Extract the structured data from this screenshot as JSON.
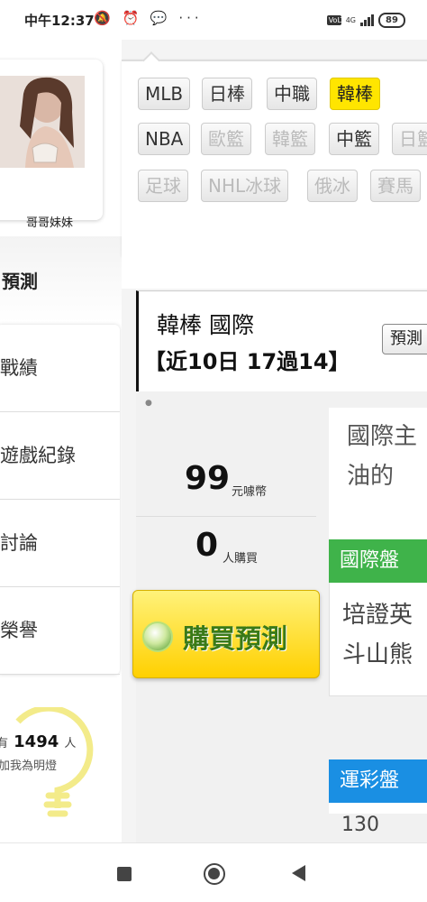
{
  "status_bar": {
    "time": "中午12:37",
    "icons_left": "🔕 ⏰ 💬 ···",
    "volte": "VoLTE",
    "network": "4G",
    "battery": "89"
  },
  "profile": {
    "name": "哥哥妹妹"
  },
  "sidebar": {
    "heading": "預測",
    "items": [
      {
        "label": "戰績"
      },
      {
        "label": "遊戲紀錄"
      },
      {
        "label": "討論"
      },
      {
        "label": "榮譽"
      }
    ],
    "fans": {
      "prefix": "有",
      "count": "1494",
      "suffix": "人",
      "subtitle": "加我為明燈"
    }
  },
  "sport_tabs": {
    "row1": [
      {
        "label": "MLB"
      },
      {
        "label": "日棒"
      },
      {
        "label": "中職"
      },
      {
        "label": "韓棒",
        "active": true
      }
    ],
    "row2": [
      {
        "label": "NBA"
      },
      {
        "label": "歐籃"
      },
      {
        "label": "韓籃"
      },
      {
        "label": "中籃"
      },
      {
        "label": "日籃"
      }
    ],
    "row3": [
      {
        "label": "足球"
      },
      {
        "label": "NHL冰球"
      },
      {
        "label": "俄冰"
      },
      {
        "label": "賽馬"
      }
    ]
  },
  "detail": {
    "title": "韓棒 國際",
    "record": "【近10日 17過14】",
    "predict_button": "預測",
    "price": "99",
    "price_unit": "元噱幣",
    "buyers": "0",
    "buyers_unit": "人購買",
    "buy_button": "購買預測",
    "info_title": "國際主\n油的",
    "board_intl": "國際盤",
    "board_intl_text": "培證英\n斗山熊",
    "board_sports": "運彩盤",
    "board_sports_value": "130"
  },
  "colors": {
    "active_tab": "#ffe500",
    "intl_board": "#3fb34a",
    "sports_board": "#1a8fe3",
    "buy_button": "#ffd000"
  }
}
